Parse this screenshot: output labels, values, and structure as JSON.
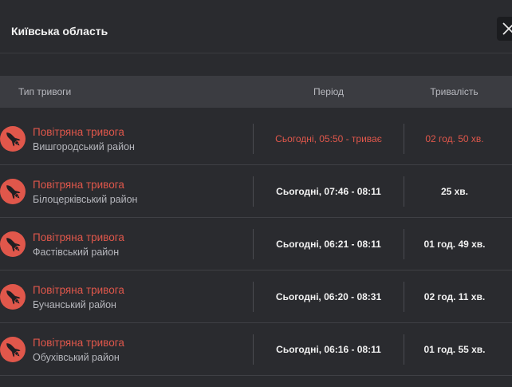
{
  "dialog": {
    "title": "Київська область"
  },
  "table": {
    "headers": {
      "type": "Тип тривоги",
      "period": "Період",
      "duration": "Тривалість"
    },
    "rows": [
      {
        "alert_type": "Повітряна тривога",
        "district": "Вишгородський район",
        "period": "Сьогодні, 05:50 - триває",
        "duration": "02 год. 50 хв.",
        "active": true
      },
      {
        "alert_type": "Повітряна тривога",
        "district": "Білоцерківський район",
        "period": "Сьогодні, 07:46 - 08:11",
        "duration": "25 хв.",
        "active": false
      },
      {
        "alert_type": "Повітряна тривога",
        "district": "Фастівський район",
        "period": "Сьогодні, 06:21 - 08:11",
        "duration": "01 год. 49 хв.",
        "active": false
      },
      {
        "alert_type": "Повітряна тривога",
        "district": "Бучанський район",
        "period": "Сьогодні, 06:20 - 08:31",
        "duration": "02 год. 11 хв.",
        "active": false
      },
      {
        "alert_type": "Повітряна тривога",
        "district": "Обухівський район",
        "period": "Сьогодні, 06:16 - 08:11",
        "duration": "01 год. 55 хв.",
        "active": false
      }
    ]
  },
  "colors": {
    "background": "#2a2b2f",
    "header_row": "#3b3c41",
    "alert_red": "#e0574b",
    "text_primary": "#f2f2f2",
    "text_secondary": "#b6b7bd"
  },
  "icons": {
    "alert_icon": "rocket-icon",
    "close_icon": "close-icon"
  }
}
